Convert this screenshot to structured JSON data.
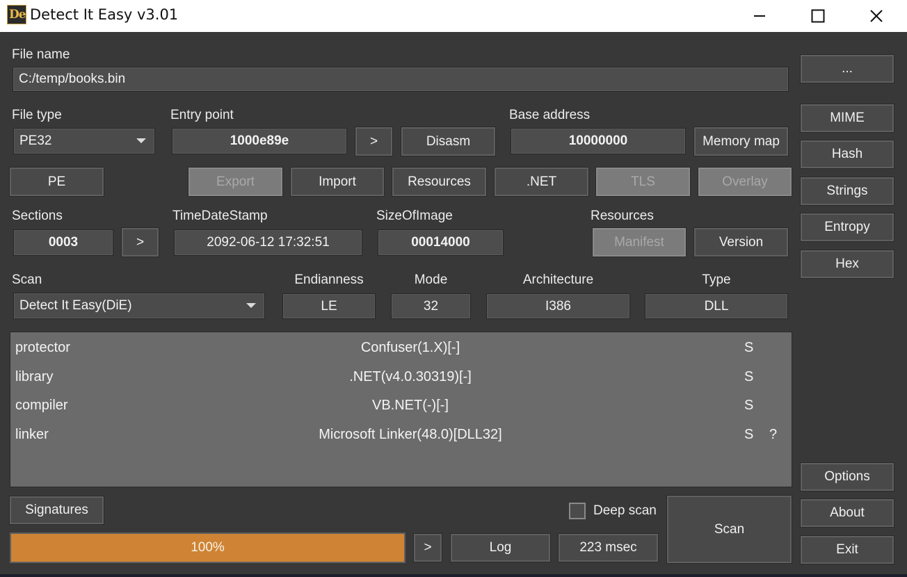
{
  "window": {
    "title": "Detect It Easy v3.01",
    "icon_text": "De"
  },
  "file": {
    "label": "File name",
    "path": "C:/temp/books.bin",
    "browse_label": "..."
  },
  "file_type": {
    "label": "File type",
    "value": "PE32"
  },
  "entry_point": {
    "label": "Entry point",
    "value": "1000e89e",
    "go_label": ">",
    "disasm_label": "Disasm"
  },
  "base_address": {
    "label": "Base address",
    "value": "10000000",
    "memory_map_label": "Memory map"
  },
  "pe_buttons": {
    "pe": "PE",
    "export": "Export",
    "import": "Import",
    "resources": "Resources",
    "net": ".NET",
    "tls": "TLS",
    "overlay": "Overlay"
  },
  "sections": {
    "label": "Sections",
    "value": "0003",
    "go_label": ">"
  },
  "timedatestamp": {
    "label": "TimeDateStamp",
    "value": "2092-06-12 17:32:51"
  },
  "size_of_image": {
    "label": "SizeOfImage",
    "value": "00014000"
  },
  "resources_group": {
    "label": "Resources",
    "manifest": "Manifest",
    "version": "Version"
  },
  "scan": {
    "label": "Scan",
    "engine": "Detect It Easy(DiE)"
  },
  "info": {
    "endianness_label": "Endianness",
    "endianness": "LE",
    "mode_label": "Mode",
    "mode": "32",
    "architecture_label": "Architecture",
    "architecture": "I386",
    "type_label": "Type",
    "type": "DLL"
  },
  "results": [
    {
      "type": "protector",
      "name": "Confuser(1.X)[-]",
      "s": "S",
      "q": ""
    },
    {
      "type": "library",
      "name": ".NET(v4.0.30319)[-]",
      "s": "S",
      "q": ""
    },
    {
      "type": "compiler",
      "name": "VB.NET(-)[-]",
      "s": "S",
      "q": ""
    },
    {
      "type": "linker",
      "name": "Microsoft Linker(48.0)[DLL32]",
      "s": "S",
      "q": "?"
    }
  ],
  "sidebar": {
    "mime": "MIME",
    "hash": "Hash",
    "strings": "Strings",
    "entropy": "Entropy",
    "hex": "Hex",
    "options": "Options",
    "about": "About",
    "exit": "Exit"
  },
  "bottom": {
    "signatures_label": "Signatures",
    "deep_scan_label": "Deep scan",
    "deep_scan_checked": false,
    "progress_text": "100%",
    "progress_value": 1.0,
    "log_go_label": ">",
    "log_label": "Log",
    "elapsed": "223 msec",
    "scan_label": "Scan"
  },
  "colors": {
    "background": "#383838",
    "progress": "#ce8434",
    "results_bg": "#6b6b6b"
  }
}
